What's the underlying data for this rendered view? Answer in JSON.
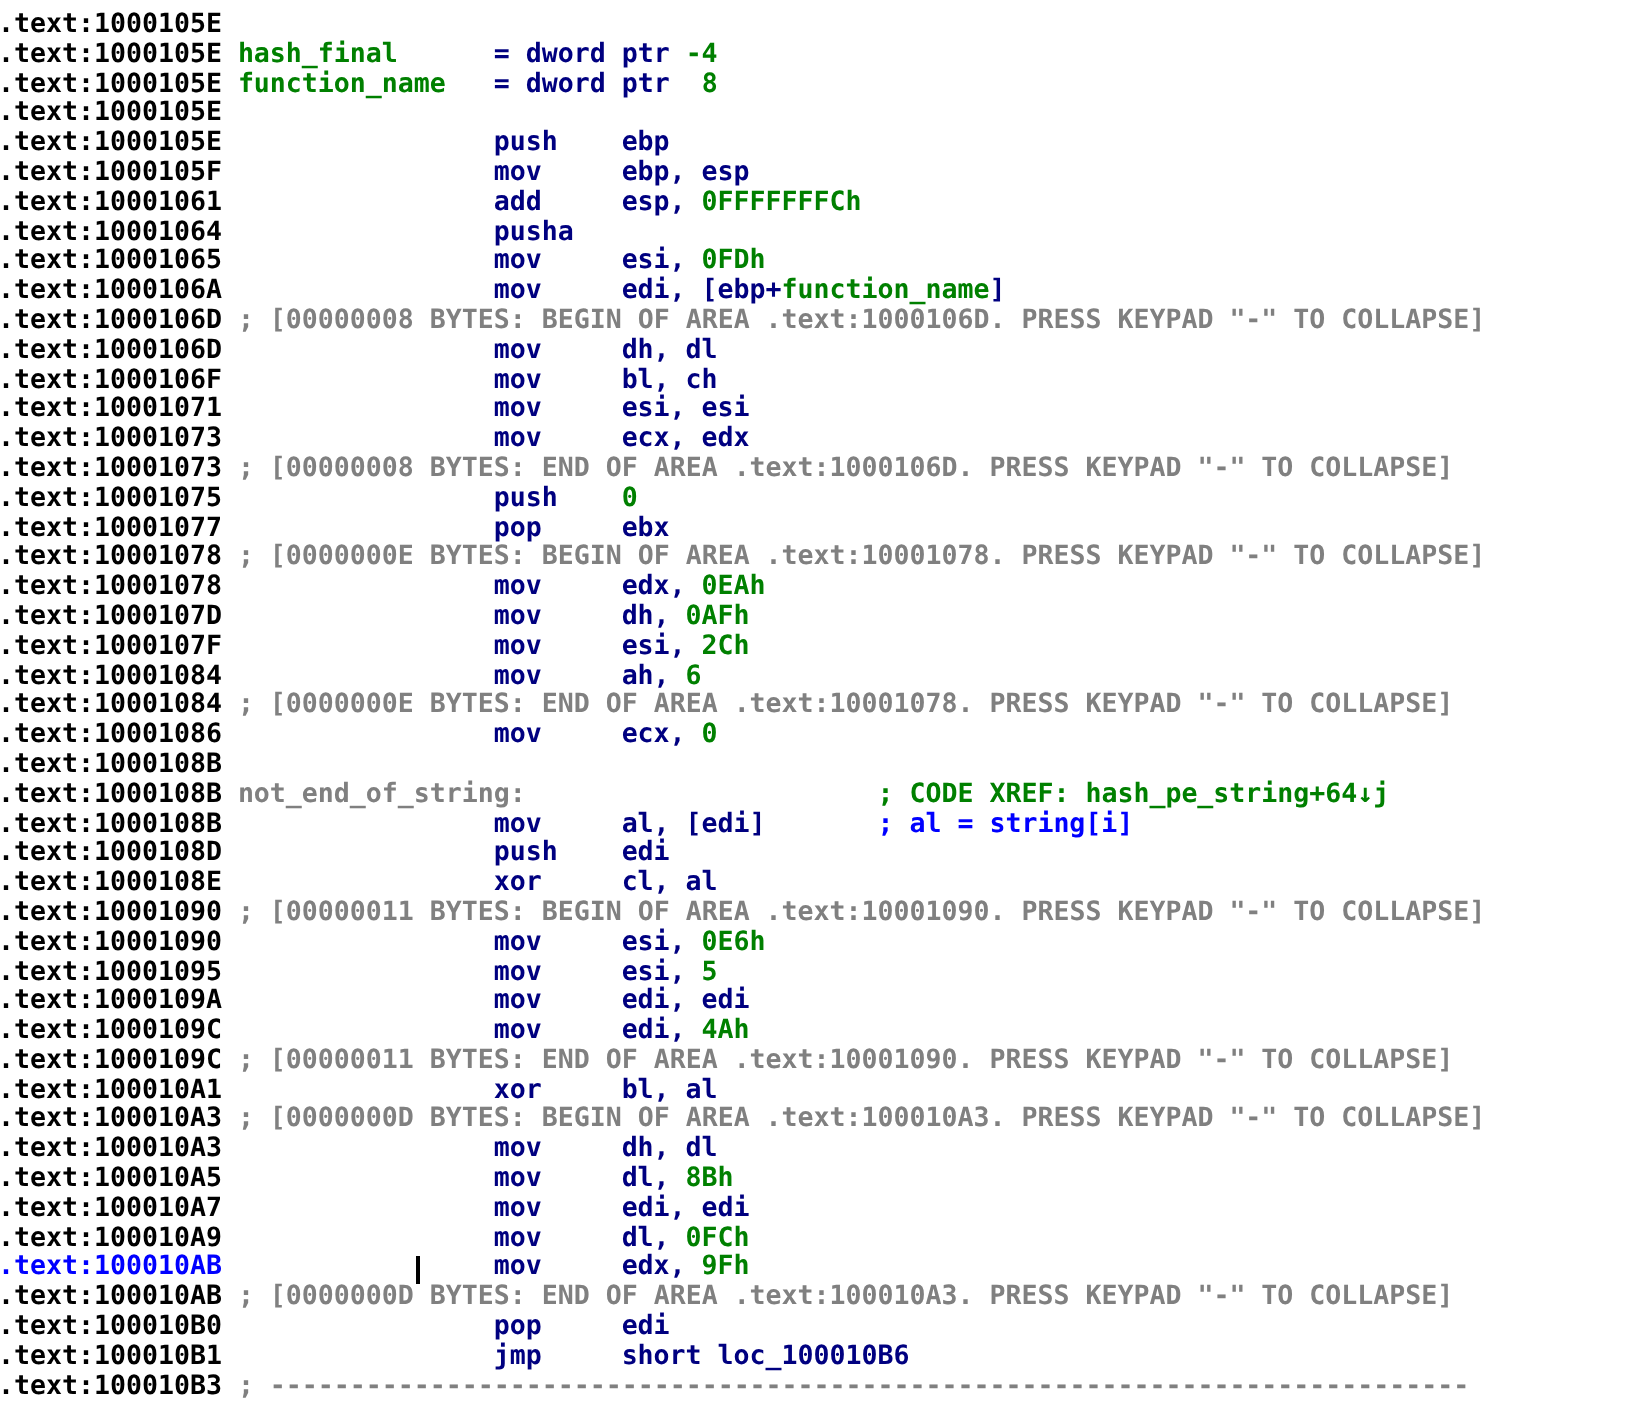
{
  "listing": [
    {
      "address": ".text:1000105E",
      "kind": "blank",
      "selected": false
    },
    {
      "address": ".text:1000105E",
      "kind": "var",
      "name": "hash_final",
      "value": [
        {
          "text": "= dword ptr ",
          "kind": "reg"
        },
        {
          "text": "-4",
          "kind": "num"
        }
      ],
      "selected": false
    },
    {
      "address": ".text:1000105E",
      "kind": "var",
      "name": "function_name",
      "value": [
        {
          "text": "= dword ptr  ",
          "kind": "reg"
        },
        {
          "text": "8",
          "kind": "num"
        }
      ],
      "selected": false
    },
    {
      "address": ".text:1000105E",
      "kind": "blank",
      "selected": false
    },
    {
      "address": ".text:1000105E",
      "kind": "instr",
      "mnemonic": "push",
      "operands": [
        {
          "text": "ebp",
          "kind": "reg"
        }
      ],
      "selected": false
    },
    {
      "address": ".text:1000105F",
      "kind": "instr",
      "mnemonic": "mov",
      "operands": [
        {
          "text": "ebp, esp",
          "kind": "reg"
        }
      ],
      "selected": false
    },
    {
      "address": ".text:10001061",
      "kind": "instr",
      "mnemonic": "add",
      "operands": [
        {
          "text": "esp, ",
          "kind": "reg"
        },
        {
          "text": "0FFFFFFFCh",
          "kind": "num"
        }
      ],
      "selected": false
    },
    {
      "address": ".text:10001064",
      "kind": "instr",
      "mnemonic": "pusha",
      "selected": false
    },
    {
      "address": ".text:10001065",
      "kind": "instr",
      "mnemonic": "mov",
      "operands": [
        {
          "text": "esi, ",
          "kind": "reg"
        },
        {
          "text": "0FDh",
          "kind": "num"
        }
      ],
      "selected": false
    },
    {
      "address": ".text:1000106A",
      "kind": "instr",
      "mnemonic": "mov",
      "operands": [
        {
          "text": "edi, [ebp+",
          "kind": "reg"
        },
        {
          "text": "function_name",
          "kind": "name"
        },
        {
          "text": "]",
          "kind": "reg"
        }
      ],
      "selected": false
    },
    {
      "address": ".text:1000106D",
      "kind": "area",
      "text": "; [00000008 BYTES: BEGIN OF AREA .text:1000106D. PRESS KEYPAD \"-\" TO COLLAPSE]",
      "selected": false
    },
    {
      "address": ".text:1000106D",
      "kind": "instr",
      "mnemonic": "mov",
      "operands": [
        {
          "text": "dh, dl",
          "kind": "reg"
        }
      ],
      "selected": false
    },
    {
      "address": ".text:1000106F",
      "kind": "instr",
      "mnemonic": "mov",
      "operands": [
        {
          "text": "bl, ch",
          "kind": "reg"
        }
      ],
      "selected": false
    },
    {
      "address": ".text:10001071",
      "kind": "instr",
      "mnemonic": "mov",
      "operands": [
        {
          "text": "esi, esi",
          "kind": "reg"
        }
      ],
      "selected": false
    },
    {
      "address": ".text:10001073",
      "kind": "instr",
      "mnemonic": "mov",
      "operands": [
        {
          "text": "ecx, edx",
          "kind": "reg"
        }
      ],
      "selected": false
    },
    {
      "address": ".text:10001073",
      "kind": "area",
      "text": "; [00000008 BYTES: END OF AREA .text:1000106D. PRESS KEYPAD \"-\" TO COLLAPSE]",
      "selected": false
    },
    {
      "address": ".text:10001075",
      "kind": "instr",
      "mnemonic": "push",
      "operands": [
        {
          "text": "0",
          "kind": "num"
        }
      ],
      "selected": false
    },
    {
      "address": ".text:10001077",
      "kind": "instr",
      "mnemonic": "pop",
      "operands": [
        {
          "text": "ebx",
          "kind": "reg"
        }
      ],
      "selected": false
    },
    {
      "address": ".text:10001078",
      "kind": "area",
      "text": "; [0000000E BYTES: BEGIN OF AREA .text:10001078. PRESS KEYPAD \"-\" TO COLLAPSE]",
      "selected": false
    },
    {
      "address": ".text:10001078",
      "kind": "instr",
      "mnemonic": "mov",
      "operands": [
        {
          "text": "edx, ",
          "kind": "reg"
        },
        {
          "text": "0EAh",
          "kind": "num"
        }
      ],
      "selected": false
    },
    {
      "address": ".text:1000107D",
      "kind": "instr",
      "mnemonic": "mov",
      "operands": [
        {
          "text": "dh, ",
          "kind": "reg"
        },
        {
          "text": "0AFh",
          "kind": "num"
        }
      ],
      "selected": false
    },
    {
      "address": ".text:1000107F",
      "kind": "instr",
      "mnemonic": "mov",
      "operands": [
        {
          "text": "esi, ",
          "kind": "reg"
        },
        {
          "text": "2Ch",
          "kind": "num"
        }
      ],
      "selected": false
    },
    {
      "address": ".text:10001084",
      "kind": "instr",
      "mnemonic": "mov",
      "operands": [
        {
          "text": "ah, ",
          "kind": "reg"
        },
        {
          "text": "6",
          "kind": "num"
        }
      ],
      "selected": false
    },
    {
      "address": ".text:10001084",
      "kind": "area",
      "text": "; [0000000E BYTES: END OF AREA .text:10001078. PRESS KEYPAD \"-\" TO COLLAPSE]",
      "selected": false
    },
    {
      "address": ".text:10001086",
      "kind": "instr",
      "mnemonic": "mov",
      "operands": [
        {
          "text": "ecx, ",
          "kind": "reg"
        },
        {
          "text": "0",
          "kind": "num"
        }
      ],
      "selected": false
    },
    {
      "address": ".text:1000108B",
      "kind": "blank",
      "selected": false
    },
    {
      "address": ".text:1000108B",
      "kind": "label",
      "name": "not_end_of_string:",
      "comment": "; CODE XREF: hash_pe_string+64↓j",
      "selected": false
    },
    {
      "address": ".text:1000108B",
      "kind": "instr",
      "mnemonic": "mov",
      "operands": [
        {
          "text": "al, [edi]",
          "kind": "reg"
        }
      ],
      "comment": "; al = string[i]",
      "selected": false
    },
    {
      "address": ".text:1000108D",
      "kind": "instr",
      "mnemonic": "push",
      "operands": [
        {
          "text": "edi",
          "kind": "reg"
        }
      ],
      "selected": false
    },
    {
      "address": ".text:1000108E",
      "kind": "instr",
      "mnemonic": "xor",
      "operands": [
        {
          "text": "cl, al",
          "kind": "reg"
        }
      ],
      "selected": false
    },
    {
      "address": ".text:10001090",
      "kind": "area",
      "text": "; [00000011 BYTES: BEGIN OF AREA .text:10001090. PRESS KEYPAD \"-\" TO COLLAPSE]",
      "selected": false
    },
    {
      "address": ".text:10001090",
      "kind": "instr",
      "mnemonic": "mov",
      "operands": [
        {
          "text": "esi, ",
          "kind": "reg"
        },
        {
          "text": "0E6h",
          "kind": "num"
        }
      ],
      "selected": false
    },
    {
      "address": ".text:10001095",
      "kind": "instr",
      "mnemonic": "mov",
      "operands": [
        {
          "text": "esi, ",
          "kind": "reg"
        },
        {
          "text": "5",
          "kind": "num"
        }
      ],
      "selected": false
    },
    {
      "address": ".text:1000109A",
      "kind": "instr",
      "mnemonic": "mov",
      "operands": [
        {
          "text": "edi, edi",
          "kind": "reg"
        }
      ],
      "selected": false
    },
    {
      "address": ".text:1000109C",
      "kind": "instr",
      "mnemonic": "mov",
      "operands": [
        {
          "text": "edi, ",
          "kind": "reg"
        },
        {
          "text": "4Ah",
          "kind": "num"
        }
      ],
      "selected": false
    },
    {
      "address": ".text:1000109C",
      "kind": "area",
      "text": "; [00000011 BYTES: END OF AREA .text:10001090. PRESS KEYPAD \"-\" TO COLLAPSE]",
      "selected": false
    },
    {
      "address": ".text:100010A1",
      "kind": "instr",
      "mnemonic": "xor",
      "operands": [
        {
          "text": "bl, al",
          "kind": "reg"
        }
      ],
      "selected": false
    },
    {
      "address": ".text:100010A3",
      "kind": "area",
      "text": "; [0000000D BYTES: BEGIN OF AREA .text:100010A3. PRESS KEYPAD \"-\" TO COLLAPSE]",
      "selected": false
    },
    {
      "address": ".text:100010A3",
      "kind": "instr",
      "mnemonic": "mov",
      "operands": [
        {
          "text": "dh, dl",
          "kind": "reg"
        }
      ],
      "selected": false
    },
    {
      "address": ".text:100010A5",
      "kind": "instr",
      "mnemonic": "mov",
      "operands": [
        {
          "text": "dl, ",
          "kind": "reg"
        },
        {
          "text": "8Bh",
          "kind": "num"
        }
      ],
      "selected": false
    },
    {
      "address": ".text:100010A7",
      "kind": "instr",
      "mnemonic": "mov",
      "operands": [
        {
          "text": "edi, edi",
          "kind": "reg"
        }
      ],
      "selected": false
    },
    {
      "address": ".text:100010A9",
      "kind": "instr",
      "mnemonic": "mov",
      "operands": [
        {
          "text": "dl, ",
          "kind": "reg"
        },
        {
          "text": "0FCh",
          "kind": "num"
        }
      ],
      "selected": false
    },
    {
      "address": ".text:100010AB",
      "kind": "instr",
      "mnemonic": "mov",
      "operands": [
        {
          "text": "edx, ",
          "kind": "reg"
        },
        {
          "text": "9Fh",
          "kind": "num"
        }
      ],
      "selected": true
    },
    {
      "address": ".text:100010AB",
      "kind": "area",
      "text": "; [0000000D BYTES: END OF AREA .text:100010A3. PRESS KEYPAD \"-\" TO COLLAPSE]",
      "selected": false
    },
    {
      "address": ".text:100010B0",
      "kind": "instr",
      "mnemonic": "pop",
      "operands": [
        {
          "text": "edi",
          "kind": "reg"
        }
      ],
      "selected": false
    },
    {
      "address": ".text:100010B1",
      "kind": "instr",
      "mnemonic": "jmp",
      "operands": [
        {
          "text": "short loc_100010B6",
          "kind": "reg"
        }
      ],
      "selected": false
    },
    {
      "address": ".text:100010B3",
      "kind": "separator",
      "text": "; ---------------------------------------------------------------------------",
      "selected": false
    }
  ]
}
